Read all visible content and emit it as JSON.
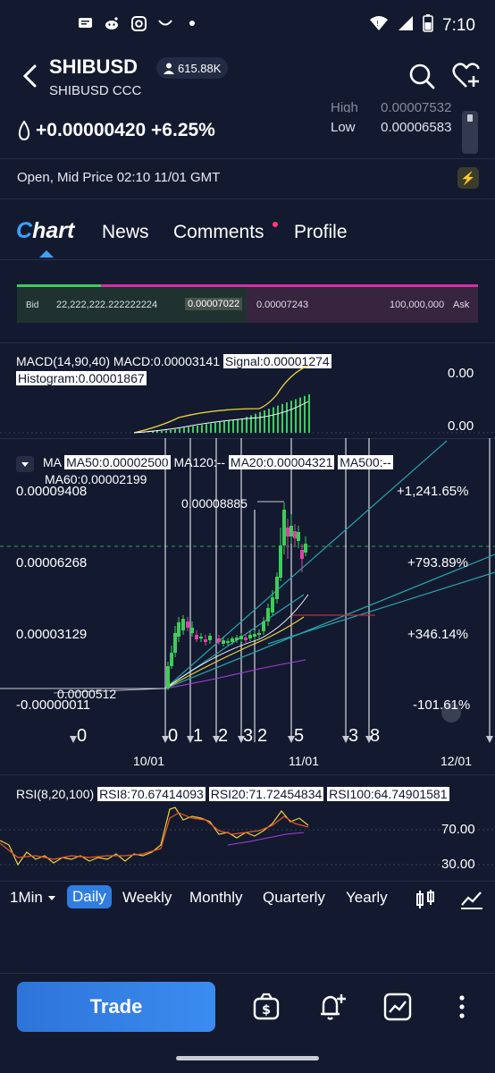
{
  "status_bar": {
    "time": "7:10",
    "icons": [
      "message-icon",
      "reddit-icon",
      "instagram-icon",
      "smile-icon",
      "dot-icon",
      "wifi-icon",
      "signal-icon",
      "battery-icon"
    ]
  },
  "header": {
    "symbol": "SHIBUSD",
    "subtitle": "SHIBUSD  CCC",
    "watchers": "615.88K"
  },
  "price": {
    "change": "+0.00000420 +6.25%",
    "high_label": "High",
    "high_value": "0.00007532",
    "low_label": "Low",
    "low_value": "0.00006583"
  },
  "market_status": "Open, Mid Price 02:10 11/01 GMT",
  "tabs": {
    "chart_c": "C",
    "chart_rest": "hart",
    "news": "News",
    "comments": "Comments",
    "profile": "Profile"
  },
  "bid_ask": {
    "bid_label": "Bid",
    "bid_size": "22,222,222.222222224",
    "bid_price": "0.00007022",
    "ask_price": "0.00007243",
    "ask_size": "100,000,000",
    "ask_label": "Ask"
  },
  "macd": {
    "label_main": "MACD(14,90,40)  MACD:0.00003141",
    "signal": "Signal:0.00001274",
    "histogram": "Histogram:0.00001867",
    "tick_top": "0.00",
    "tick_bottom": "0.00"
  },
  "main_chart": {
    "ma_prefix": "MA",
    "ma50": "MA50:0.00002500",
    "ma120": "MA120:--",
    "ma20": "MA20:0.00004321",
    "ma500": "MA500:--",
    "ma60": "MA60:0.00002199",
    "y_labels": [
      "0.00009408",
      "0.00006268",
      "0.00003129",
      "-0.00000011"
    ],
    "pct_labels": [
      "+1,241.65%",
      "+793.89%",
      "+346.14%",
      "-101.61%"
    ],
    "peak_label": "0.00008885",
    "low_label": "0.0000512",
    "wave_labels": [
      "0",
      "0",
      "1",
      "2",
      "3",
      "2",
      "5",
      "3",
      "8"
    ],
    "dates": [
      "10/01",
      "11/01",
      "12/01"
    ]
  },
  "rsi": {
    "label_main": "RSI(8,20,100)",
    "rsi8": "RSI8:70.67414093",
    "rsi20": "RSI20:71.72454834",
    "rsi100": "RSI100:64.74901581",
    "tick_70": "70.00",
    "tick_30": "30.00"
  },
  "periods": {
    "interval": "1Min",
    "daily": "Daily",
    "weekly": "Weekly",
    "monthly": "Monthly",
    "quarterly": "Quarterly",
    "yearly": "Yearly"
  },
  "bottom_bar": {
    "trade": "Trade"
  },
  "colors": {
    "background": "#131a30",
    "accent": "#3ba2ff",
    "up": "#3ccd5a",
    "down": "#e23ea8",
    "macd_line": "#f0d23c"
  }
}
